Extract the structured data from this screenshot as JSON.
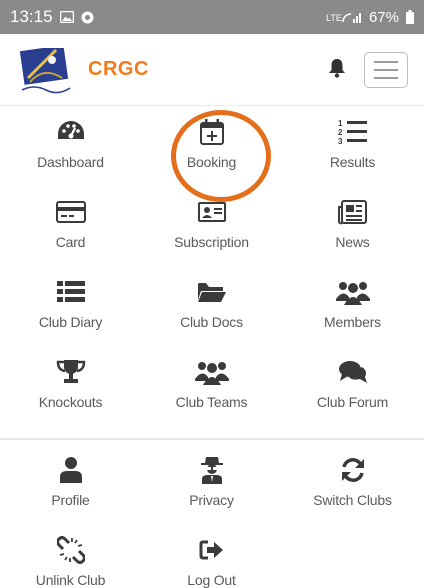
{
  "status": {
    "time": "13:15",
    "battery": "67%",
    "colors": {
      "bar": "#8a8a8a"
    }
  },
  "header": {
    "brand": "CRGC",
    "accent": "#f07d1b"
  },
  "menu": [
    {
      "label": "Dashboard",
      "icon": "dashboard-gauge-icon"
    },
    {
      "label": "Booking",
      "icon": "calendar-plus-icon"
    },
    {
      "label": "Results",
      "icon": "numbered-list-icon"
    },
    {
      "label": "Card",
      "icon": "credit-card-icon"
    },
    {
      "label": "Subscription",
      "icon": "id-card-icon"
    },
    {
      "label": "News",
      "icon": "newspaper-icon"
    },
    {
      "label": "Club Diary",
      "icon": "list-icon"
    },
    {
      "label": "Club Docs",
      "icon": "folder-open-icon"
    },
    {
      "label": "Members",
      "icon": "users-icon"
    },
    {
      "label": "Knockouts",
      "icon": "trophy-icon"
    },
    {
      "label": "Club Teams",
      "icon": "users-icon"
    },
    {
      "label": "Club Forum",
      "icon": "comments-icon"
    }
  ],
  "bottom_menu": [
    {
      "label": "Profile",
      "icon": "user-icon"
    },
    {
      "label": "Privacy",
      "icon": "user-secret-icon"
    },
    {
      "label": "Switch Clubs",
      "icon": "refresh-icon"
    },
    {
      "label": "Unlink Club",
      "icon": "unlink-icon"
    },
    {
      "label": "Log Out",
      "icon": "sign-out-icon"
    }
  ],
  "highlight": {
    "target": "Booking",
    "color": "#e46e19"
  }
}
